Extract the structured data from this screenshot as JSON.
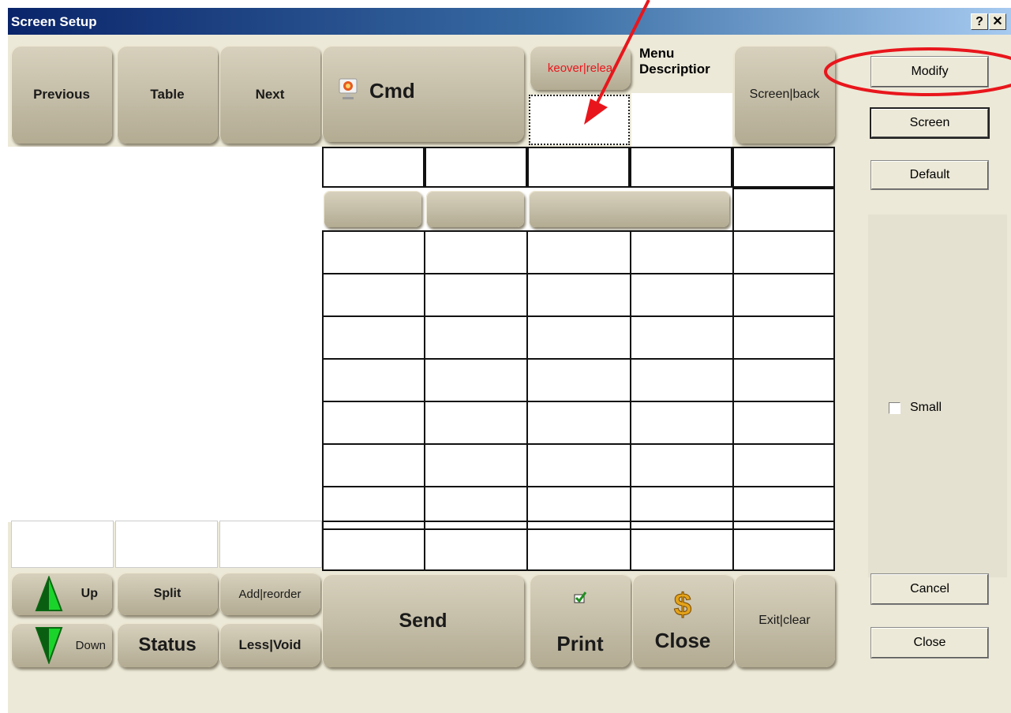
{
  "window": {
    "title": "Screen Setup",
    "help_label": "?",
    "close_label": "✕"
  },
  "top_buttons": {
    "previous": "Previous",
    "table": "Table",
    "next": "Next",
    "cmd": "Cmd",
    "takeover": "keover|relea",
    "menu_description_line1": "Menu",
    "menu_description_line2": "Descriptior",
    "screen_back": "Screen|back"
  },
  "bottom_buttons": {
    "up": "Up",
    "down": "Down",
    "split": "Split",
    "status": "Status",
    "add_reorder": "Add|reorder",
    "less_void": "Less|Void",
    "send": "Send",
    "print": "Print",
    "close": "Close",
    "exit_clear": "Exit|clear"
  },
  "side_panel": {
    "modify": "Modify",
    "screen": "Screen",
    "default": "Default",
    "small_label": "Small",
    "small_checked": false,
    "cancel": "Cancel",
    "close": "Close"
  },
  "colors": {
    "annotation": "#e8161c",
    "titlebar": "#0a246a",
    "arrow_up": "#1bd42b",
    "dollar": "#e3a31a"
  },
  "icons": [
    "monitor-icon",
    "up-arrow-icon",
    "down-arrow-icon",
    "checkmark-icon",
    "dollar-icon"
  ]
}
